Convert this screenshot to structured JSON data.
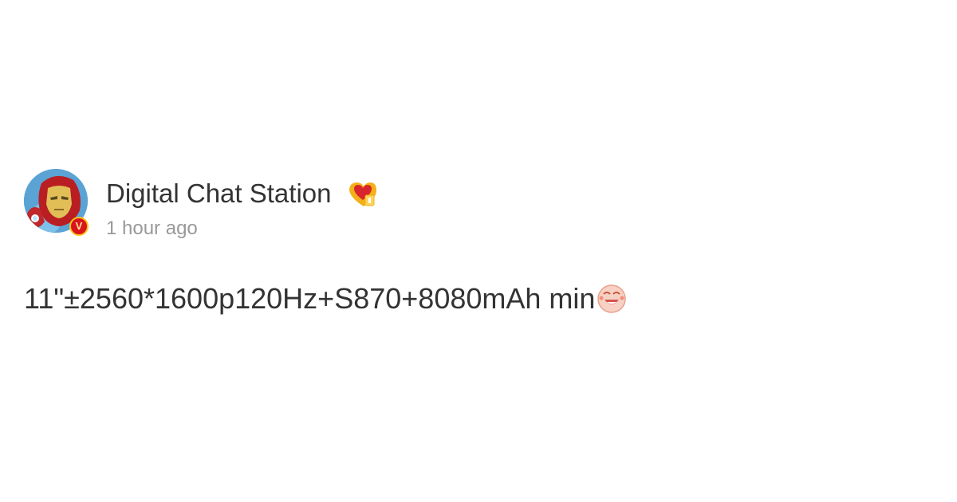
{
  "post": {
    "author": {
      "name": "Digital Chat Station",
      "avatar_icon": "iron-man-avatar-icon",
      "verified_badge": "V",
      "member_icon": "heart-member-icon"
    },
    "timestamp": "1 hour ago",
    "content_text": "11\"±2560*1600p120Hz+S870+8080mAh min",
    "content_emoji": "laughing-face-emoji-icon"
  },
  "colors": {
    "text_primary": "#333333",
    "text_secondary": "#999999",
    "badge_red": "#d9141a",
    "badge_gold": "#ffc21a",
    "background": "#ffffff"
  }
}
